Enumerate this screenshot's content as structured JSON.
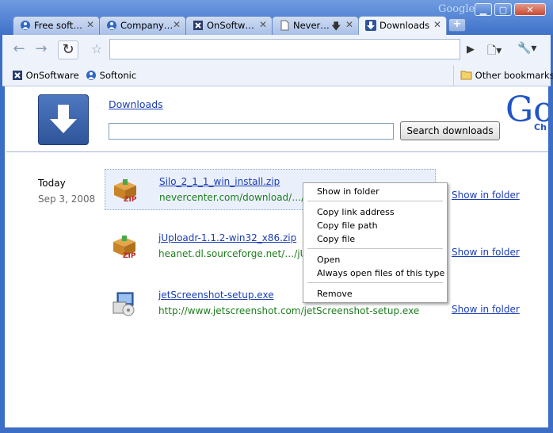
{
  "window": {
    "brand": "Google",
    "controls": [
      "minimize",
      "maximize",
      "close"
    ]
  },
  "tabs": [
    {
      "label": "Free soft…",
      "icon": "softonic-icon",
      "active": false
    },
    {
      "label": "Company…",
      "icon": "softonic-icon",
      "active": false
    },
    {
      "label": "OnSoftw…",
      "icon": "onsoftware-icon",
      "active": false
    },
    {
      "label": "Never…",
      "icon": "page-icon",
      "active": false,
      "downloading": true
    },
    {
      "label": "Downloads",
      "icon": "downloads-icon",
      "active": true
    }
  ],
  "toolbar": {
    "url": ""
  },
  "bookmarks": {
    "items": [
      {
        "label": "OnSoftware",
        "icon": "onsoftware-icon"
      },
      {
        "label": "Softonic",
        "icon": "softonic-icon"
      }
    ],
    "other": "Other bookmarks"
  },
  "page": {
    "title": "Downloads",
    "search_placeholder": "",
    "search_button": "Search downloads",
    "logo_text": "Go",
    "logo_sub": "Ch"
  },
  "date_group": {
    "label": "Today",
    "date": "Sep 3, 2008"
  },
  "downloads": [
    {
      "name": "Silo_2_1_1_win_install.zip",
      "url": "nevercenter.com/download/…/Sil",
      "action": "Show in folder",
      "icon": "zip-icon"
    },
    {
      "name": "jUploadr-1.1.2-win32_x86.zip",
      "url": "heanet.dl.sourceforge.net/…/jUpl",
      "action": "Show in folder",
      "icon": "zip-icon"
    },
    {
      "name": "jetScreenshot-setup.exe",
      "url": "http://www.jetscreenshot.com/jetScreenshot-setup.exe",
      "action": "Show in folder",
      "icon": "installer-icon"
    }
  ],
  "context_menu": {
    "items": [
      "Show in folder",
      "Copy link address",
      "Copy file path",
      "Copy file",
      "Open",
      "Always open files of this type",
      "Remove"
    ]
  },
  "colors": {
    "frame": "#3e72c9",
    "link": "#1a3db6",
    "url_green": "#1e7d1e"
  }
}
